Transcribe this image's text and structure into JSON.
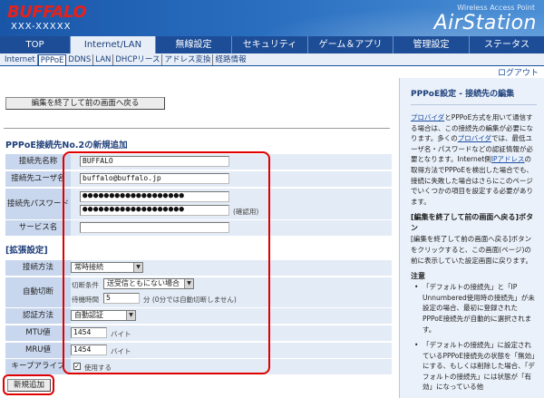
{
  "header": {
    "logo": "BUFFALO",
    "model": "XXX-XXXXX",
    "tagline": "Wireless Access Point",
    "brand": "AirStation"
  },
  "nav": {
    "tabs": [
      "TOP",
      "Internet/LAN",
      "無線設定",
      "セキュリティ",
      "ゲーム＆アプリ",
      "管理設定",
      "ステータス"
    ],
    "active": "Internet/LAN"
  },
  "subnav": {
    "tabs": [
      "Internet",
      "PPPoE",
      "DDNS",
      "LAN",
      "DHCPリース",
      "アドレス変換",
      "経路情報"
    ],
    "active": "PPPoE"
  },
  "logout": "ログアウト",
  "main": {
    "back_button": "編集を終了して前の画面へ戻る",
    "section_title": "PPPoE接続先No.2の新規追加",
    "fields": {
      "name": {
        "label": "接続先名称",
        "value": "BUFFALO"
      },
      "user": {
        "label": "接続先ユーザ名",
        "value": "buffalo@buffalo.jp"
      },
      "password": {
        "label": "接続先パスワード",
        "value": "●●●●●●●●●●●●●●●●●●●",
        "confirm_value": "●●●●●●●●●●●●●●●●●●●",
        "confirm_note": "(確認用)"
      },
      "service": {
        "label": "サービス名",
        "value": ""
      }
    },
    "extended_title": "[拡張設定]",
    "extended": {
      "method": {
        "label": "接続方法",
        "value": "常時接続"
      },
      "disconnect": {
        "label": "自動切断",
        "condition_label": "切断条件",
        "condition_value": "送受信ともにない場合",
        "wait_label": "待機時間",
        "wait_value": "5",
        "wait_note": "分 (0分では自動切断しません)"
      },
      "auth": {
        "label": "認証方法",
        "value": "自動認証"
      },
      "mtu": {
        "label": "MTU値",
        "value": "1454",
        "unit": "バイト"
      },
      "mru": {
        "label": "MRU値",
        "value": "1454",
        "unit": "バイト"
      },
      "keepalive": {
        "label": "キープアライブ",
        "checkbox_label": "使用する",
        "checked": true
      }
    },
    "add_button": "新規追加"
  },
  "help": {
    "title": "PPPoE設定 - 接続先の編集",
    "intro_link1": "プロバイダ",
    "intro_1": "とPPPoE方式を用いて通信する場合は、この接続先の編集が必要になります。多くの",
    "intro_link2": "プロバイダ",
    "intro_2": "では、最低ユーザ名・パスワードなどの認証情報が必要となります。Internet側",
    "intro_link3": "IPアドレス",
    "intro_3": "の取得方法でPPPoEを検出した場合でも、接続に失敗した場合はさらにこのページでいくつかの項目を設定する必要があります。",
    "back_heading": "[編集を終了して前の画面へ戻る]ボタン",
    "back_text": "[編集を終了して前の画面へ戻る]ボタンをクリックすると、この画面(ページ)の前に表示していた設定画面に戻ります。",
    "note_heading": "注意",
    "notes": [
      "「デフォルトの接続先」と「IP Unnumbered使用時の接続先」が未設定の場合、最初に登録されたPPPoE接続先が自動的に選択されます。",
      "「デフォルトの接続先」に設定されているPPPoE接続先の状態を「無効」にする、もしくは削除した場合、「デフォルトの接続先」には状態が「有効」になっている他"
    ]
  }
}
